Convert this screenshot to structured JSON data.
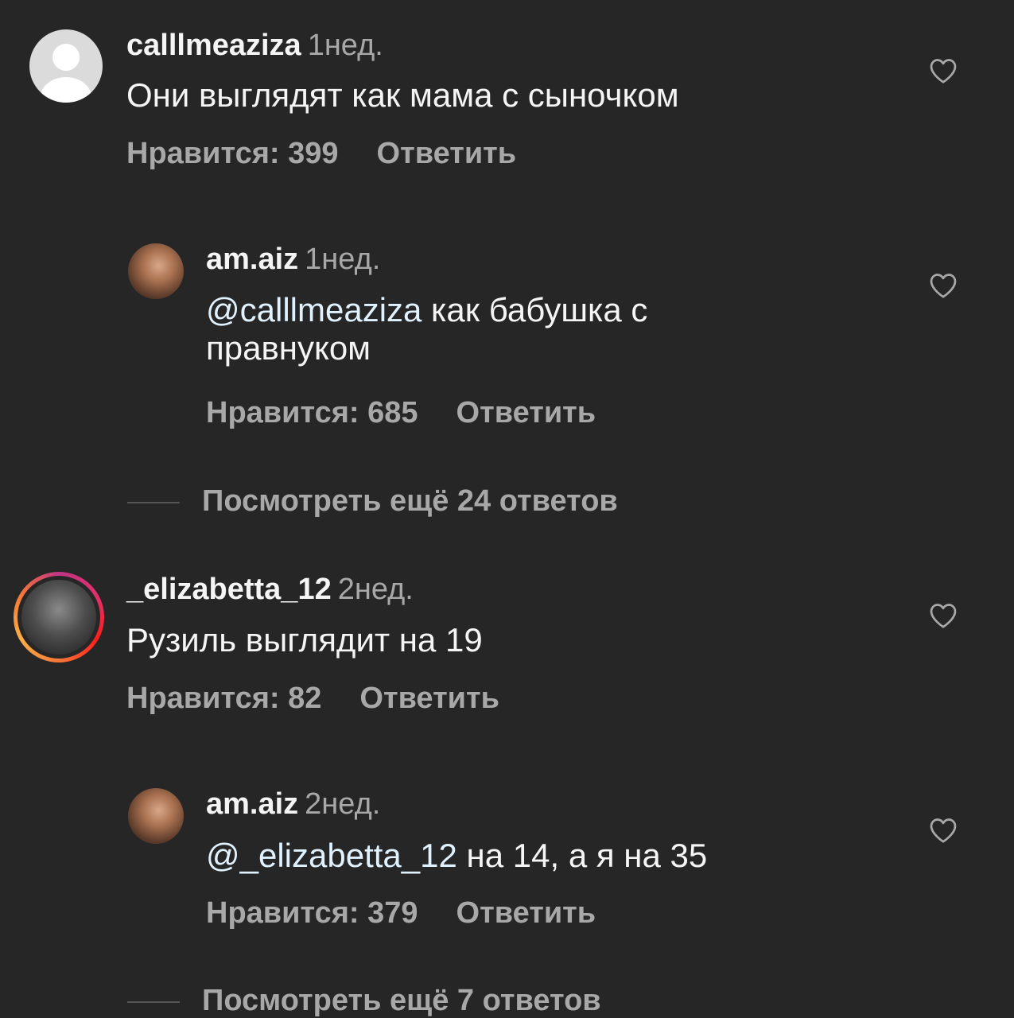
{
  "comments": [
    {
      "username": "calllmeaziza",
      "time": "1нед.",
      "text": "Они выглядят как мама с сыночком",
      "likes": "Нравится: 399",
      "reply": "Ответить"
    },
    {
      "username": "am.aiz",
      "time": "1нед.",
      "mention": "@calllmeaziza",
      "text": " как бабушка с правнуком",
      "likes": "Нравится: 685",
      "reply": "Ответить"
    },
    {
      "view_more": "Посмотреть ещё 24 ответов"
    },
    {
      "username": "_elizabetta_12",
      "time": "2нед.",
      "text": "Рузиль выглядит на 19",
      "likes": "Нравится: 82",
      "reply": "Ответить"
    },
    {
      "username": "am.aiz",
      "time": "2нед.",
      "mention": "@_elizabetta_12",
      "text": " на 14, а я на 35",
      "likes": "Нравится: 379",
      "reply": "Ответить"
    },
    {
      "view_more": "Посмотреть ещё 7 ответов"
    }
  ],
  "icons": {
    "like": "heart-outline-icon"
  },
  "colors": {
    "background": "#262626",
    "primary_text": "#f5f5f5",
    "secondary_text": "#a8a8a8",
    "mention": "#e0f1ff"
  }
}
